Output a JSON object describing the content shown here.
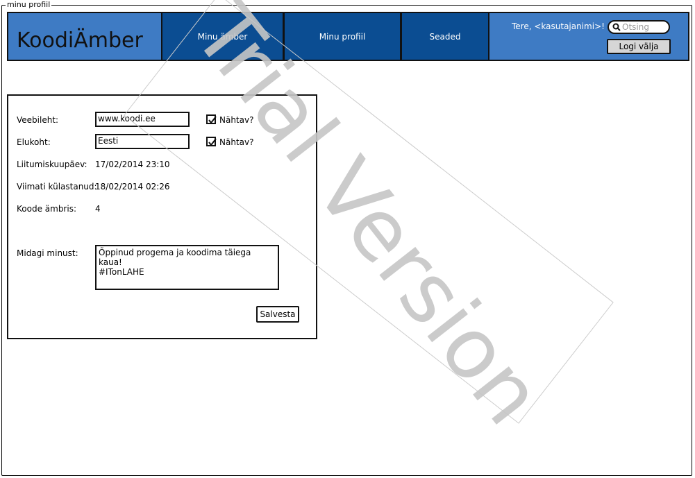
{
  "window": {
    "title": "minu profiil"
  },
  "nav": {
    "logo": "KoodiÄmber",
    "items": [
      {
        "label": "Minu ämber"
      },
      {
        "label": "Minu profiil"
      },
      {
        "label": "Seaded"
      }
    ],
    "greeting": "Tere, <kasutajanimi>!",
    "search_placeholder": "Otsing",
    "logout_label": "Logi välja"
  },
  "profile": {
    "website": {
      "label": "Veebileht:",
      "value": "www.koodi.ee",
      "visible_label": "Nähtav?",
      "visible_checked": true
    },
    "location": {
      "label": "Elukoht:",
      "value": "Eesti",
      "visible_label": "Nähtav?",
      "visible_checked": true
    },
    "joined": {
      "label": "Liitumiskuupäev:",
      "value": "17/02/2014 23:10"
    },
    "last_visit": {
      "label": "Viimati külastanud:",
      "value": "18/02/2014 02:26"
    },
    "code_count": {
      "label": "Koode ämbris:",
      "value": "4"
    },
    "about": {
      "label": "Midagi minust:",
      "value": "Õppinud progema ja koodima täiega kaua!\n#ITonLAHE"
    },
    "save_label": "Salvesta"
  },
  "watermark": {
    "text": "Trial Version"
  },
  "colors": {
    "nav_bg": "#3e7bc4",
    "nav_item_bg": "#0b4d92",
    "logout_bg": "#d6d6d6"
  }
}
